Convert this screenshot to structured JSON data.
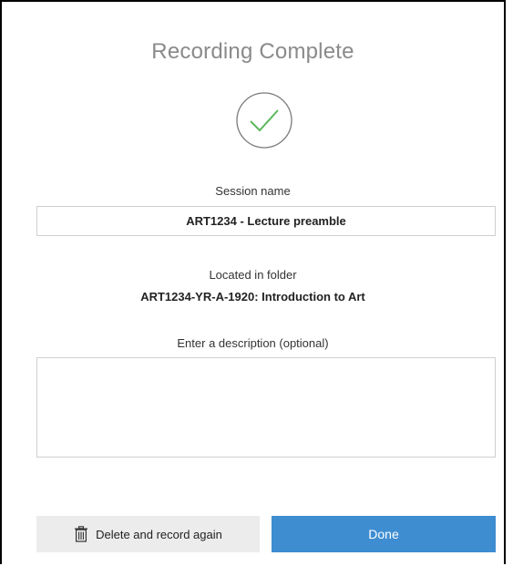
{
  "dialog": {
    "title": "Recording Complete",
    "success_icon": "check-circle-icon",
    "success_color": "#5cb85c"
  },
  "session": {
    "label": "Session name",
    "value": "ART1234 - Lecture preamble"
  },
  "folder": {
    "label": "Located in folder",
    "name": "ART1234-YR-A-1920: Introduction to Art"
  },
  "description": {
    "label": "Enter a description (optional)",
    "value": ""
  },
  "actions": {
    "delete_label": "Delete and record again",
    "delete_icon": "trash-icon",
    "done_label": "Done",
    "done_color": "#3e8dd1"
  }
}
